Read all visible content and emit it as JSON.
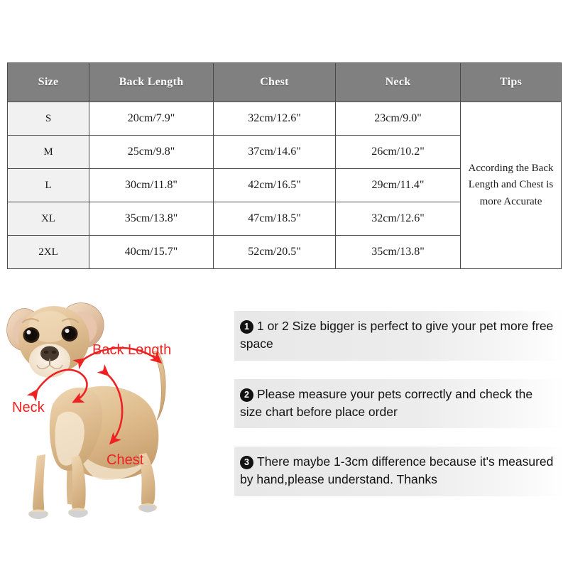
{
  "size_table": {
    "headers": [
      "Size",
      "Back Length",
      "Chest",
      "Neck",
      "Tips"
    ],
    "rows": [
      {
        "size": "S",
        "back_length": "20cm/7.9\"",
        "chest": "32cm/12.6\"",
        "neck": "23cm/9.0\""
      },
      {
        "size": "M",
        "back_length": "25cm/9.8\"",
        "chest": "37cm/14.6\"",
        "neck": "26cm/10.2\""
      },
      {
        "size": "L",
        "back_length": "30cm/11.8\"",
        "chest": "42cm/16.5\"",
        "neck": "29cm/11.4\""
      },
      {
        "size": "XL",
        "back_length": "35cm/13.8\"",
        "chest": "47cm/18.5\"",
        "neck": "32cm/12.6\""
      },
      {
        "size": "2XL",
        "back_length": "40cm/15.7\"",
        "chest": "52cm/20.5\"",
        "neck": "35cm/13.8\""
      }
    ],
    "tips_text": "According the Back Length and Chest is more Accurate",
    "header_bg": "#808080",
    "header_text_color": "#ffffff",
    "size_cell_bg": "#f1f1f1",
    "border_color": "#4a4a4a"
  },
  "diagram": {
    "subject": "chihuahua-dog-photo",
    "labels": {
      "back_length": "Back Length",
      "neck": "Neck",
      "chest": "Chest"
    },
    "annotation_color": "#ee2222"
  },
  "notes": [
    {
      "number": "1",
      "text": "1 or 2 Size bigger is perfect to give your pet more free space"
    },
    {
      "number": "2",
      "text": "Please measure your pets correctly and check the size chart before place order"
    },
    {
      "number": "3",
      "text": "There maybe 1-3cm difference because it's measured by hand,please understand. Thanks"
    }
  ]
}
